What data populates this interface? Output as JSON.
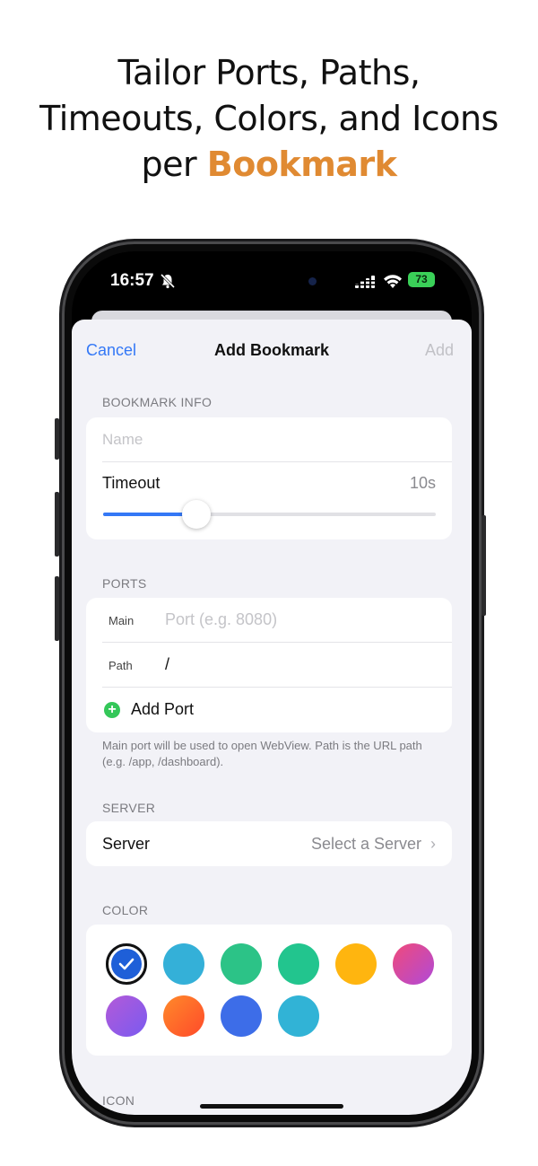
{
  "marketing": {
    "line1": "Tailor Ports, Paths,",
    "line2": "Timeouts, Colors, and Icons",
    "line3_prefix": "per ",
    "line3_accent": "Bookmark",
    "accent_color": "#e08a32"
  },
  "status_bar": {
    "time": "16:57",
    "battery": "73",
    "icons": [
      "bell-slash-icon",
      "signal-icon",
      "wifi-icon",
      "battery-icon"
    ]
  },
  "nav": {
    "cancel": "Cancel",
    "title": "Add Bookmark",
    "add": "Add",
    "accent_color": "#3478f6"
  },
  "bookmark_info": {
    "section_title": "BOOKMARK INFO",
    "name_placeholder": "Name",
    "timeout_label": "Timeout",
    "timeout_value": "10s",
    "timeout_fraction": 0.28
  },
  "ports": {
    "section_title": "PORTS",
    "main_label": "Main",
    "main_placeholder": "Port (e.g. 8080)",
    "path_label": "Path",
    "path_value": "/",
    "add_port": "Add Port",
    "footnote": "Main port will be used to open WebView. Path is the URL path (e.g. /app, /dashboard)."
  },
  "server": {
    "section_title": "SERVER",
    "label": "Server",
    "value": "Select a Server"
  },
  "color": {
    "section_title": "COLOR",
    "selected_index": 0,
    "swatches": [
      {
        "name": "navy",
        "fill": "#1e5fd8"
      },
      {
        "name": "sky-blue",
        "fill": "#34b0d8"
      },
      {
        "name": "green",
        "fill": "#2cc387"
      },
      {
        "name": "teal",
        "fill": "#22c58e"
      },
      {
        "name": "orange",
        "fill": "#ffb50f"
      },
      {
        "name": "pink",
        "fill": "linear-gradient(135deg,#f04a7a,#b04ad8)"
      },
      {
        "name": "purple",
        "fill": "linear-gradient(135deg,#b35ad8,#7a5af0)"
      },
      {
        "name": "red-orange",
        "fill": "linear-gradient(135deg,#ff8a2a,#ff4a2a)"
      },
      {
        "name": "blue",
        "fill": "#3d6de8"
      },
      {
        "name": "cyan",
        "fill": "#31b3d6"
      }
    ]
  },
  "icon": {
    "section_title": "ICON"
  }
}
